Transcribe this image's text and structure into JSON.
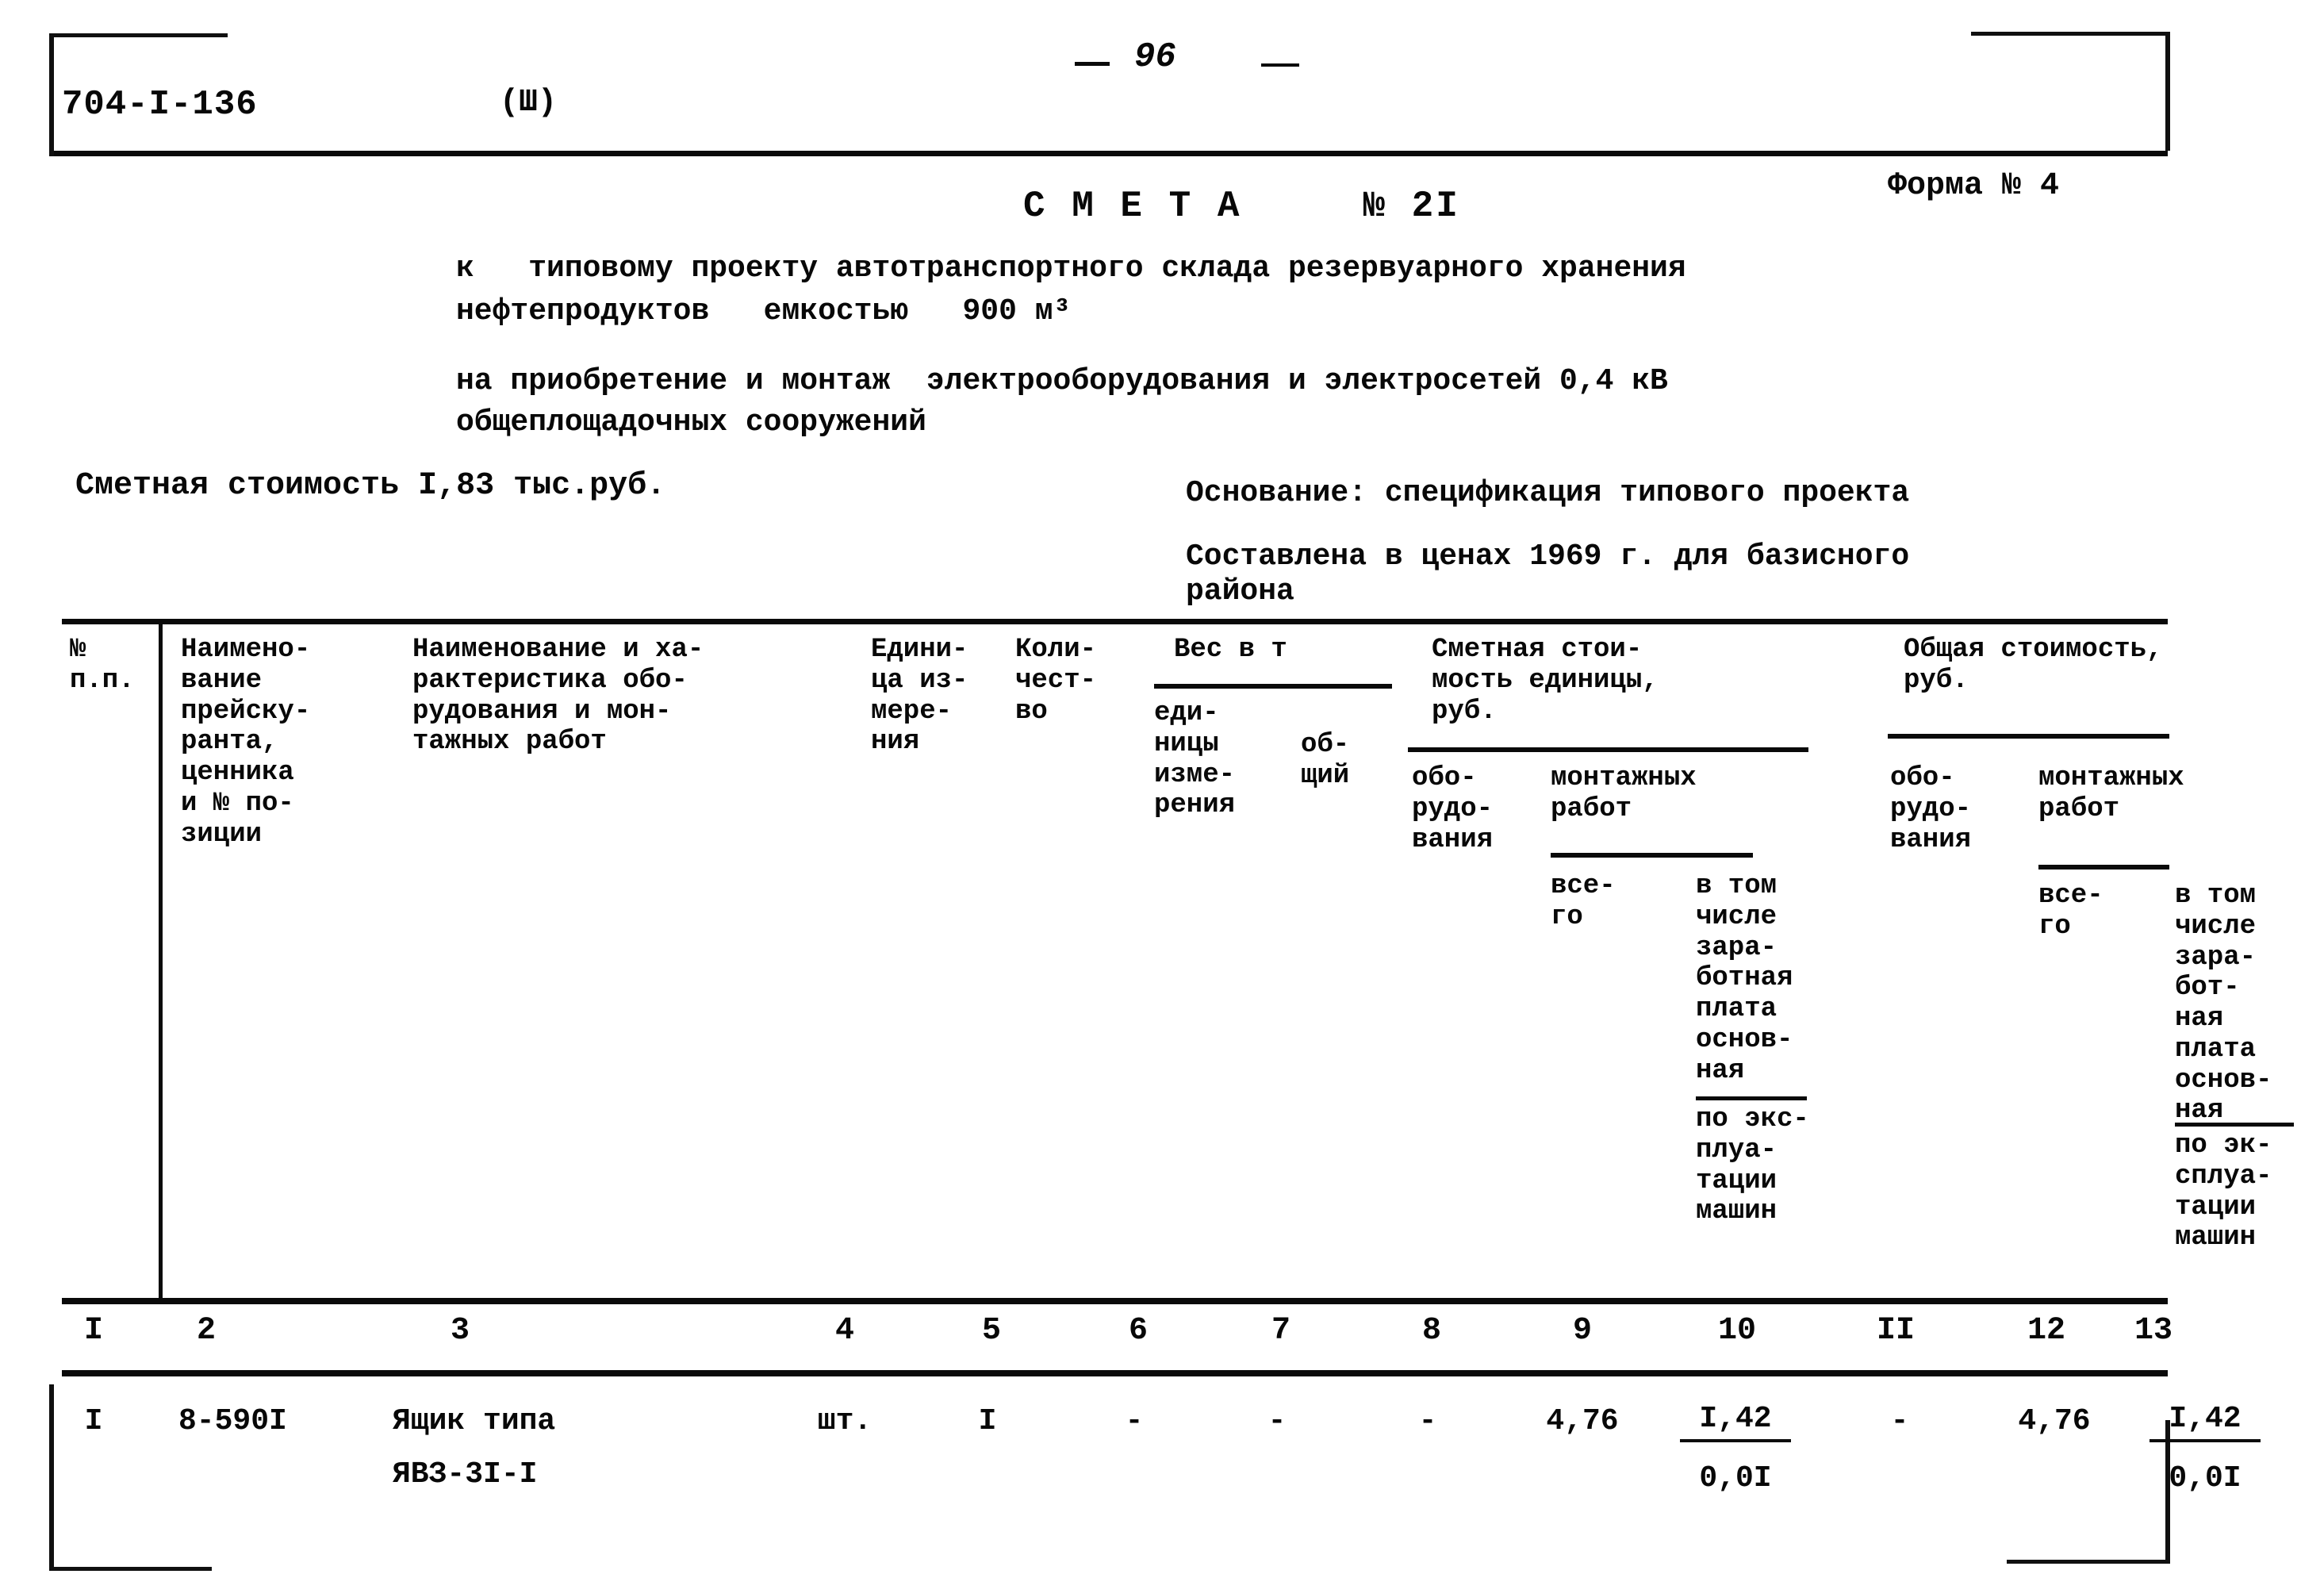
{
  "header": {
    "doc_code": "704-I-136",
    "variant": "(Ш)",
    "page_number": "96",
    "form_label": "Форма № 4"
  },
  "title": {
    "main": "С М Е Т А     № 2I",
    "subject_line1": "к   типовому проекту автотранспортного склада резервуарного хранения",
    "subject_line2": "нефтепродуктов   емкостью   900 м³",
    "scope_line1": "на приобретение и монтаж  электрооборудования и электросетей 0,4 кВ",
    "scope_line2": "общеплощадочных сооружений"
  },
  "summary": {
    "estimate_cost": "Сметная стоимость I,83 тыс.руб.",
    "basis": "Основание: спецификация типового проекта",
    "prices_line1": "Составлена в ценах 1969 г. для базисного",
    "prices_line2": "района"
  },
  "table": {
    "headers": {
      "col1": "№\nп.п.",
      "col2": "Наимено-\nвание\nпрейску-\nранта,\nценника\nи № по-\nзиции",
      "col3": "Наименование и ха-\nрактеристика обо-\nрудования и мон-\nтажных работ",
      "col4": "Едини-\nца из-\nмере-\nния",
      "col5": "Коли-\nчест-\nво",
      "weight_group": "Вес в т",
      "col6": "еди-\nницы\nизме-\nрения",
      "col7": "об-\nщий",
      "unit_cost_group": "Сметная стои-\nмость единицы,\nруб.",
      "col8": "обо-\nрудо-\nвания",
      "install_group_1": "монтажных\nработ",
      "col9": "все-\nго",
      "col10_a": "в том\nчисле\nзара-\nботная\nплата\nоснов-\nная",
      "col10_b": "по экс-\nплуа-\nтации\nмашин",
      "total_cost_group": "Общая стоимость,\nруб.",
      "col11": "обо-\nрудо-\nвания",
      "install_group_2": "монтажных\nработ",
      "col12": "все-\nго",
      "col13_a": "в том\nчисле\nзара-\nбот-\nная\nплата\nоснов-\nная",
      "col13_b": "по эк-\nсплуа-\nтации\nмашин"
    },
    "column_numbers": [
      "I",
      "2",
      "3",
      "4",
      "5",
      "6",
      "7",
      "8",
      "9",
      "10",
      "II",
      "12",
      "13"
    ],
    "rows": [
      {
        "n": "I",
        "price_ref": "8-590I",
        "name_line1": "Ящик типа",
        "name_line2": "ЯВЗ-3I-I",
        "unit": "шт.",
        "qty": "I",
        "weight_unit": "-",
        "weight_total": "-",
        "equip_unit_cost": "-",
        "install_unit_all": "4,76",
        "install_unit_wage": "I,42",
        "install_unit_mach": "0,0I",
        "equip_total": "-",
        "install_total_all": "4,76",
        "install_total_wage": "I,42",
        "install_total_mach": "0,0I"
      }
    ]
  }
}
